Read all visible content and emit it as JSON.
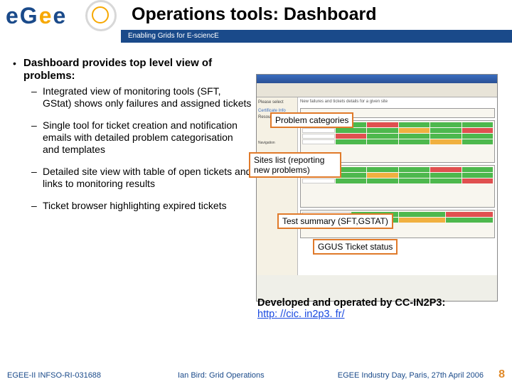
{
  "header": {
    "logo_text": "eGee",
    "title": "Operations tools: Dashboard",
    "band": "Enabling Grids for E-sciencE"
  },
  "main": {
    "heading": "Dashboard provides top level view of problems:",
    "items": [
      "Integrated view of monitoring tools (SFT, GStat) shows only failures and assigned tickets",
      "Single tool for ticket creation and notification emails with detailed problem categorisation and templates",
      "Detailed site view with table of open tickets and links to monitoring results",
      "Ticket browser highlighting expired tickets"
    ]
  },
  "callouts": {
    "c1": "Problem categories",
    "c2": "Sites list (reporting new problems)",
    "c3": "Test summary (SFT,GSTAT)",
    "c4": "GGUS Ticket status"
  },
  "dev": {
    "text": "Developed and operated by CC-IN2P3:",
    "link": "http: //cic. in2p3. fr/"
  },
  "footer": {
    "left": "EGEE-II INFSO-RI-031688",
    "center": "Ian Bird: Grid Operations",
    "right": "EGEE Industry Day, Paris, 27th April 2006",
    "num": "8"
  }
}
